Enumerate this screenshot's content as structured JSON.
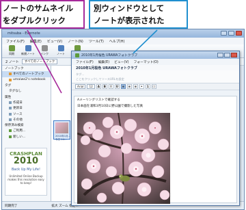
{
  "callouts": {
    "left": [
      "ノートのサムネイル",
      "をダブルクリック"
    ],
    "right": [
      "別ウィンドウとして",
      "ノートが表示された"
    ]
  },
  "main_window": {
    "title": "mitsuba - Evernote",
    "menu": [
      "ファイル(F)",
      "編集(E)",
      "ビュー(V)",
      "ノート(N)",
      "ツール(T)",
      "ヘルプ(H)"
    ],
    "toolbar": [
      "同期",
      "新規ノート",
      "インク",
      "ノート",
      "ウェブ",
      "新規",
      "共有"
    ],
    "notes_count": "2 ノート",
    "notes_filter": "すべてのノートブック",
    "sidebar": {
      "notebooks_header": "ノートブック",
      "notebooks": [
        "すべてのノートブック",
        "umaiwe2's notebook"
      ],
      "tags_header": "タグ",
      "tags": [
        "タグなし"
      ],
      "attributes_header": "属性",
      "attributes": [
        "作成日",
        "更新日",
        "ソース",
        "その他"
      ],
      "saved_header": "保存済み検索",
      "saved": [
        "ご利用...",
        "新しい..."
      ]
    },
    "ad": {
      "brand": "CRASHPLAN",
      "year": "2010",
      "tagline": "Back Up My Life!",
      "fineprint": "Unlimited Online Backup makes this resolution easy to keep!"
    },
    "thumbnail": {
      "line1": "2010年1月...",
      "line2": "今日 14:..."
    },
    "status": {
      "left": "同期完了",
      "right": "拡大 ズーム 指定..."
    }
  },
  "note_window": {
    "title": "2010年1月桜色 URAWAフォトクラブ",
    "menu": [
      "ファイル(F)",
      "編集(E)",
      "ビュー(V)",
      "フォーマット(O)"
    ],
    "header": "2010年1月桜色 URAWAフォトクラブ",
    "fields": {
      "tags_placeholder": "タグ...",
      "url_placeholder": "ここをクリックしてソースURLを設定"
    },
    "format": {
      "font": "Arial",
      "size": "12"
    },
    "body_lines": [
      "Aメーリングリストで確認する",
      "日本画を浦和3月10日に野公園で撮影した写真"
    ]
  }
}
